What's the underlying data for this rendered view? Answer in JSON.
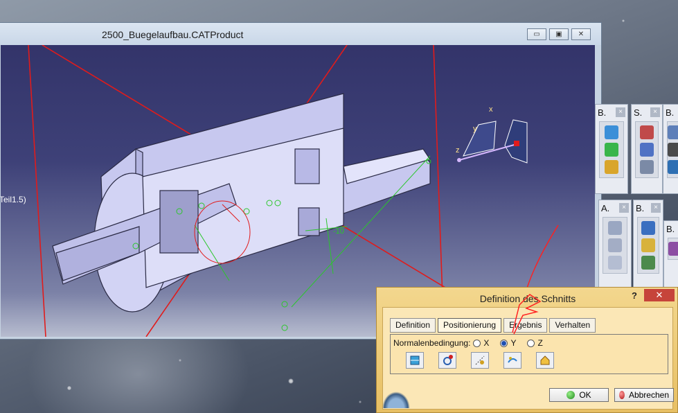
{
  "window": {
    "title": "2500_Buegelaufbau.CATProduct",
    "minimize_label": "▭",
    "restore_label": "▣",
    "close_label": "✕"
  },
  "viewport": {
    "partial_tree_label": "Teil1.5)",
    "compass_labels": {
      "x": "x",
      "y": "y",
      "z": "z"
    },
    "dimensions": [
      "-10"
    ]
  },
  "toolbars": [
    {
      "title": "B.",
      "close": "×"
    },
    {
      "title": "S.",
      "close": "×"
    },
    {
      "title": "B.",
      "close": ""
    },
    {
      "title": "A.",
      "close": "×"
    },
    {
      "title": "B.",
      "close": "×"
    },
    {
      "title": "B.",
      "close": ""
    }
  ],
  "dialog": {
    "title": "Definition des Schnitts",
    "help": "?",
    "close": "✕",
    "tabs": [
      "Definition",
      "Positionierung",
      "Ergebnis",
      "Verhalten"
    ],
    "active_tab": "Positionierung",
    "normal_label": "Normalenbedingung:",
    "options": [
      "X",
      "Y",
      "Z"
    ],
    "selected_option": "Y",
    "ok_label": "OK",
    "cancel_label": "Abbrechen"
  },
  "colors": {
    "accent": "#1e4fb0",
    "dialog_bg": "#f3d78e",
    "viewport_top": "#33346a",
    "section_red": "#e11b1b"
  }
}
